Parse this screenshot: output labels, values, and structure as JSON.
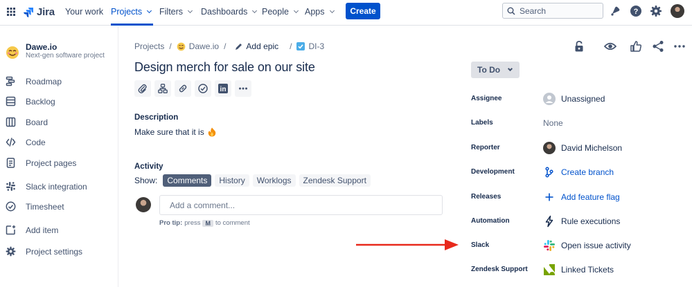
{
  "nav": {
    "logo": "Jira",
    "items": [
      {
        "label": "Your work"
      },
      {
        "label": "Projects"
      },
      {
        "label": "Filters"
      },
      {
        "label": "Dashboards"
      },
      {
        "label": "People"
      },
      {
        "label": "Apps"
      }
    ],
    "create_label": "Create",
    "search_placeholder": "Search"
  },
  "sidebar": {
    "project_name": "Dawe.io",
    "project_type": "Next-gen software project",
    "items": [
      {
        "label": "Roadmap",
        "icon": "roadmap-icon"
      },
      {
        "label": "Backlog",
        "icon": "backlog-icon"
      },
      {
        "label": "Board",
        "icon": "board-icon"
      },
      {
        "label": "Code",
        "icon": "code-icon"
      },
      {
        "label": "Project pages",
        "icon": "page-icon"
      },
      {
        "label": "Slack integration",
        "icon": "slack-icon"
      },
      {
        "label": "Timesheet",
        "icon": "check-circle-icon"
      },
      {
        "label": "Add item",
        "icon": "add-item-icon"
      },
      {
        "label": "Project settings",
        "icon": "gear-icon"
      }
    ]
  },
  "breadcrumb": {
    "projects": "Projects",
    "project": "Dawe.io",
    "add_epic": "Add epic",
    "issue_key": "DI-3"
  },
  "issue": {
    "title": "Design merch for sale on our site",
    "description_label": "Description",
    "description_text": "Make sure that it is",
    "activity_label": "Activity",
    "show_label": "Show:",
    "activity_tabs": [
      "Comments",
      "History",
      "Worklogs",
      "Zendesk Support"
    ],
    "comment_placeholder": "Add a comment...",
    "protip_prefix": "Pro tip:",
    "protip_press": "press",
    "protip_key": "M",
    "protip_suffix": "to comment"
  },
  "details": {
    "status": "To Do",
    "fields": [
      {
        "label": "Assignee",
        "value": "Unassigned"
      },
      {
        "label": "Labels",
        "value": "None"
      },
      {
        "label": "Reporter",
        "value": "David Michelson"
      },
      {
        "label": "Development",
        "value": "Create branch"
      },
      {
        "label": "Releases",
        "value": "Add feature flag"
      },
      {
        "label": "Automation",
        "value": "Rule executions"
      },
      {
        "label": "Slack",
        "value": "Open issue activity"
      },
      {
        "label": "Zendesk Support",
        "value": "Linked Tickets"
      }
    ]
  },
  "colors": {
    "brand": "#0052cc",
    "arrow": "#e8291c"
  }
}
